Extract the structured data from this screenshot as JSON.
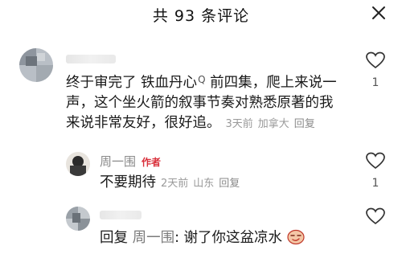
{
  "header": {
    "title": "共 93 条评论"
  },
  "comments": [
    {
      "like_count": "1",
      "text_line1_a": "终于审完了 铁血丹心",
      "search_mark": "Q",
      "text_line1_b": " 前四集，爬上来说一",
      "text_line2": "声，这个坐火箭的叙事节奏对熟悉原著的我",
      "text_line3": "来说非常友好，很好追。",
      "time": "3天前",
      "location": "加拿大",
      "reply": "回复"
    },
    {
      "author": "周一围",
      "badge": "作者",
      "like_count": "1",
      "text": "不要期待",
      "time": "2天前",
      "location": "山东",
      "reply": "回复"
    },
    {
      "text_prefix": "回复",
      "reply_to": "周一围",
      "text_body": ": 谢了你这盆凉水",
      "emoji": "smirk-face-emoji"
    }
  ],
  "icons": {
    "close": "close-icon",
    "like": "heart-outline-icon"
  },
  "colors": {
    "badge": "#d9303b",
    "meta": "#9a9a9a"
  }
}
